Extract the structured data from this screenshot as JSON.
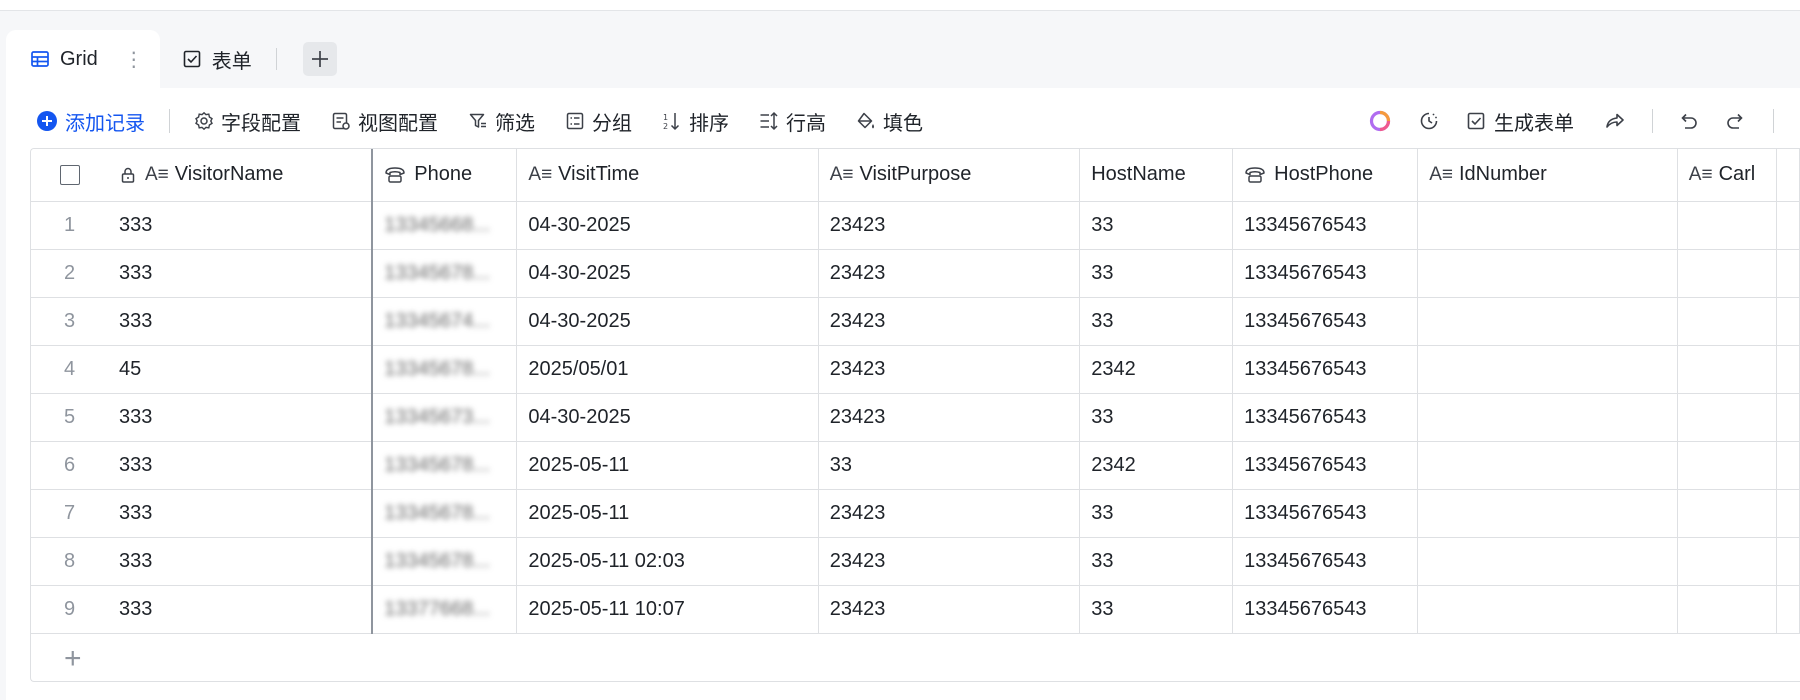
{
  "tabs": [
    {
      "label": "Grid",
      "icon": "grid-view-icon",
      "active": true
    },
    {
      "label": "表单",
      "icon": "form-view-icon",
      "active": false
    }
  ],
  "toolbar": {
    "add_record": "添加记录",
    "field_config": "字段配置",
    "view_config": "视图配置",
    "filter": "筛选",
    "group": "分组",
    "sort": "排序",
    "row_height": "行高",
    "fill_color": "填色"
  },
  "toolbar_right": {
    "generate_form": "生成表单"
  },
  "columns": [
    {
      "label": "VisitorName",
      "icon": "text-field-icon",
      "locked": true
    },
    {
      "label": "Phone",
      "icon": "phone-field-icon"
    },
    {
      "label": "VisitTime",
      "icon": "text-field-icon"
    },
    {
      "label": "VisitPurpose",
      "icon": "text-field-icon"
    },
    {
      "label": "HostName",
      "icon": ""
    },
    {
      "label": "HostPhone",
      "icon": "phone-field-icon"
    },
    {
      "label": "IdNumber",
      "icon": "text-field-icon"
    },
    {
      "label": "Carl",
      "icon": "text-field-icon"
    }
  ],
  "rows": [
    {
      "n": "1",
      "visitor": "333",
      "phone": "13345668...",
      "time": "04-30-2025",
      "purpose": "23423",
      "host": "33",
      "host_phone": "13345676543",
      "id": "",
      "car": ""
    },
    {
      "n": "2",
      "visitor": "333",
      "phone": "13345678...",
      "time": "04-30-2025",
      "purpose": "23423",
      "host": "33",
      "host_phone": "13345676543",
      "id": "",
      "car": ""
    },
    {
      "n": "3",
      "visitor": "333",
      "phone": "13345674...",
      "time": "04-30-2025",
      "purpose": "23423",
      "host": "33",
      "host_phone": "13345676543",
      "id": "",
      "car": ""
    },
    {
      "n": "4",
      "visitor": "45",
      "phone": "13345678...",
      "time": "2025/05/01",
      "purpose": "23423",
      "host": "2342",
      "host_phone": "13345676543",
      "id": "",
      "car": ""
    },
    {
      "n": "5",
      "visitor": "333",
      "phone": "13345673...",
      "time": "04-30-2025",
      "purpose": "23423",
      "host": "33",
      "host_phone": "13345676543",
      "id": "",
      "car": ""
    },
    {
      "n": "6",
      "visitor": "333",
      "phone": "13345678...",
      "time": "2025-05-11",
      "purpose": "33",
      "host": "2342",
      "host_phone": "13345676543",
      "id": "",
      "car": ""
    },
    {
      "n": "7",
      "visitor": "333",
      "phone": "13345678...",
      "time": "2025-05-11",
      "purpose": "23423",
      "host": "33",
      "host_phone": "13345676543",
      "id": "",
      "car": ""
    },
    {
      "n": "8",
      "visitor": "333",
      "phone": "13345678...",
      "time": "2025-05-11 02:03",
      "purpose": "23423",
      "host": "33",
      "host_phone": "13345676543",
      "id": "",
      "car": ""
    },
    {
      "n": "9",
      "visitor": "333",
      "phone": "13377668...",
      "time": "2025-05-11 10:07",
      "purpose": "23423",
      "host": "33",
      "host_phone": "13345676543",
      "id": "",
      "car": ""
    }
  ],
  "colors": {
    "accent": "#1456f0",
    "border": "#dee0e3",
    "muted": "#8f959e"
  }
}
